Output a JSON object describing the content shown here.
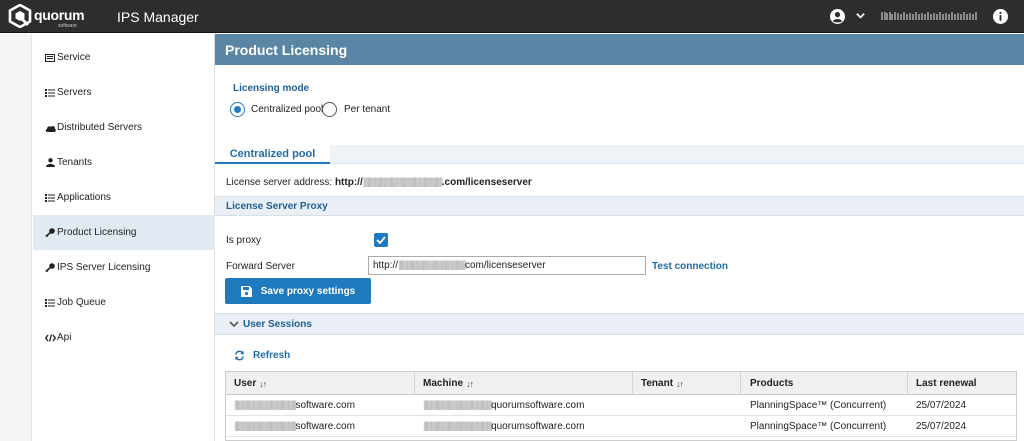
{
  "app": {
    "logo_text": "quorum",
    "logo_sub": "software",
    "title": "IPS Manager"
  },
  "topbar": {
    "user_icon": "user-circle-icon",
    "caret_icon": "chevron-down-icon",
    "info_icon": "info-circle-icon"
  },
  "sidebar": {
    "items": [
      {
        "label": "Service",
        "icon": "server-box-icon"
      },
      {
        "label": "Servers",
        "icon": "list-icon"
      },
      {
        "label": "Distributed Servers",
        "icon": "cloud-icon"
      },
      {
        "label": "Tenants",
        "icon": "person-icon"
      },
      {
        "label": "Applications",
        "icon": "list-icon"
      },
      {
        "label": "Product Licensing",
        "icon": "key-icon",
        "active": true
      },
      {
        "label": "IPS Server Licensing",
        "icon": "key-icon"
      },
      {
        "label": "Job Queue",
        "icon": "list-icon"
      },
      {
        "label": "Api",
        "icon": "code-icon"
      }
    ]
  },
  "page": {
    "title": "Product Licensing",
    "licensing_mode_label": "Licensing mode",
    "radio_options": [
      {
        "label": "Centralized pool",
        "selected": true
      },
      {
        "label": "Per tenant",
        "selected": false
      }
    ],
    "tab_label": "Centralized pool",
    "license_address_label": "License server address:",
    "license_address_prefix": "http://",
    "license_address_suffix": ".com/licenseserver"
  },
  "proxy": {
    "section_title": "License Server Proxy",
    "is_proxy_label": "Is proxy",
    "is_proxy_checked": true,
    "forward_server_label": "Forward Server",
    "forward_server_prefix": "http://",
    "forward_server_suffix": "com/licenseserver",
    "test_connection_label": "Test connection",
    "save_label": "Save proxy settings"
  },
  "sessions": {
    "section_title": "User Sessions",
    "refresh_label": "Refresh",
    "columns": [
      "User",
      "Machine",
      "Tenant",
      "Products",
      "Last renewal"
    ],
    "rows": [
      {
        "user_suffix": "software.com",
        "machine_suffix": "quorumsoftware.com",
        "tenant": "",
        "product": "PlanningSpace™ (Concurrent)",
        "last_renewal": "25/07/2024"
      },
      {
        "user_suffix": "software.com",
        "machine_suffix": "quorumsoftware.com",
        "tenant": "",
        "product": "PlanningSpace™ (Concurrent)",
        "last_renewal": "25/07/2024"
      }
    ]
  },
  "colors": {
    "topbar_bg": "#2d2d2d",
    "header_bg": "#5a85a5",
    "accent": "#1f7ac0",
    "active_item_bg": "#e1e9f3"
  }
}
